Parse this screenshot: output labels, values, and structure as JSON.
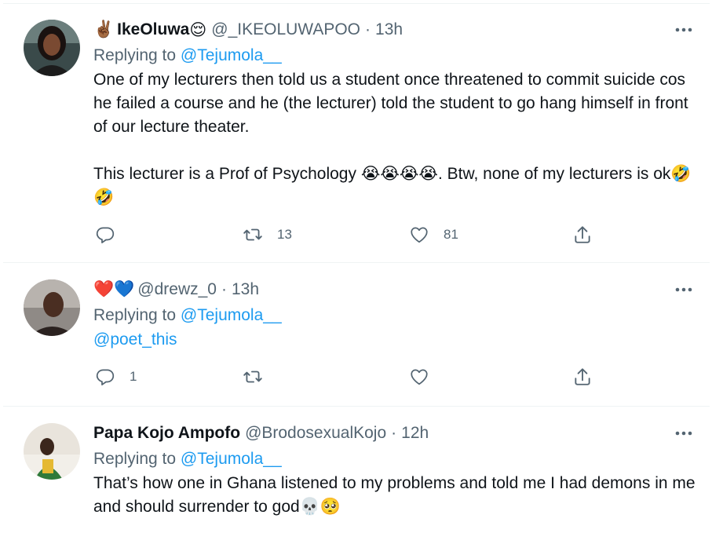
{
  "tweets": [
    {
      "name_emoji_prefix": "✌🏾",
      "name": "IkeOluwa",
      "name_emoji_suffix": "😌",
      "handle": "@_IKEOLUWAPOO",
      "time": "13h",
      "replying_label": "Replying to",
      "replying_to": "@Tejumola__",
      "paragraph1": "One of my lecturers then told us a student once threatened to commit suicide cos he failed a course and he (the lecturer) told the student to go hang himself in front of our lecture theater.",
      "paragraph2_a": "This lecturer is a Prof of Psychology",
      "paragraph2_emojis": "😭😭😭😭",
      "paragraph2_b": ". Btw, none of my lecturers is ok",
      "paragraph2_end_emojis": "🤣🤣",
      "reply_count": "",
      "retweet_count": "13",
      "like_count": "81"
    },
    {
      "name": "❤️💙",
      "handle": "@drewz_0",
      "time": "13h",
      "replying_label": "Replying to",
      "replying_to": "@Tejumola__",
      "mention": "@poet_this",
      "reply_count": "1",
      "retweet_count": "",
      "like_count": ""
    },
    {
      "name": "Papa Kojo Ampofo",
      "handle": "@BrodosexualKojo",
      "time": "12h",
      "replying_label": "Replying to",
      "replying_to": "@Tejumola__",
      "text": "That’s how one in Ghana listened to my problems and told me I had demons in me and should surrender to god",
      "end_emojis": "💀🥺"
    }
  ],
  "ui": {
    "separator": "·"
  },
  "colors": {
    "link": "#1d9bf0",
    "secondary": "#536471",
    "primary": "#0f1419",
    "border": "#eff3f4"
  }
}
